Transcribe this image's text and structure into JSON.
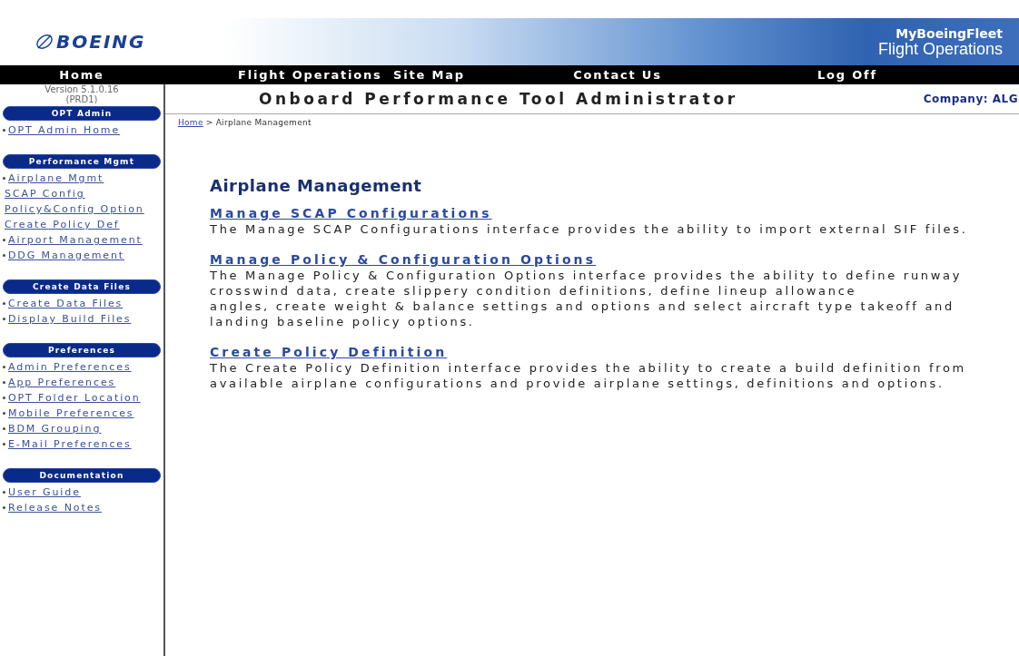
{
  "banner": {
    "logo": "BOEING",
    "portal": "MyBoeingFleet",
    "section": "Flight Operations"
  },
  "nav": [
    "Home",
    "Flight Operations",
    "Site Map",
    "Contact Us",
    "Log Off"
  ],
  "version": "Version  5.1.0.16",
  "build": "(PRD1)",
  "page_title": "Onboard Performance Tool Administrator",
  "company": "Company: ALG",
  "breadcrumb": {
    "link": "Home",
    "separator": ">",
    "current": "Airplane Management"
  },
  "sidebar": [
    {
      "title": "OPT Admin",
      "items": [
        {
          "label": "OPT Admin Home",
          "kind": "bullet"
        }
      ]
    },
    {
      "title": "Performance Mgmt",
      "items": [
        {
          "label": "Airplane Mgmt",
          "kind": "bullet"
        },
        {
          "label": "SCAP Config",
          "kind": "sub"
        },
        {
          "label": "Policy&Config Option",
          "kind": "sub"
        },
        {
          "label": "Create Policy Def",
          "kind": "sub"
        },
        {
          "label": "Airport Management",
          "kind": "bullet"
        },
        {
          "label": "DDG Management",
          "kind": "bullet"
        }
      ]
    },
    {
      "title": "Create Data Files",
      "items": [
        {
          "label": "Create Data Files",
          "kind": "bullet"
        },
        {
          "label": "Display Build Files",
          "kind": "bullet"
        }
      ]
    },
    {
      "title": "Preferences",
      "items": [
        {
          "label": "Admin Preferences",
          "kind": "bullet"
        },
        {
          "label": "App Preferences",
          "kind": "bullet"
        },
        {
          "label": "OPT Folder Location",
          "kind": "bullet"
        },
        {
          "label": "Mobile Preferences",
          "kind": "bullet"
        },
        {
          "label": "BDM Grouping",
          "kind": "bullet"
        },
        {
          "label": "E-Mail Preferences",
          "kind": "bullet"
        }
      ]
    },
    {
      "title": "Documentation",
      "items": [
        {
          "label": "User Guide",
          "kind": "bullet"
        },
        {
          "label": "Release Notes",
          "kind": "bullet"
        }
      ]
    }
  ],
  "heading": "Airplane Management",
  "sections": [
    {
      "link": "Manage SCAP Configurations",
      "lines": [
        "The Manage SCAP Configurations interface provides the ability to import external SIF files."
      ]
    },
    {
      "link": "Manage Policy & Configuration Options",
      "lines": [
        "The Manage Policy & Configuration Options interface provides the ability to define runway",
        "crosswind data, create slippery condition definitions, define lineup allowance",
        "angles, create weight & balance settings and options and select aircraft type takeoff and",
        "landing baseline policy options."
      ]
    },
    {
      "link": "Create Policy Definition",
      "lines": [
        "The Create Policy Definition interface provides the ability to create a build definition from",
        "available airplane configurations and provide airplane settings, definitions and options."
      ]
    }
  ]
}
